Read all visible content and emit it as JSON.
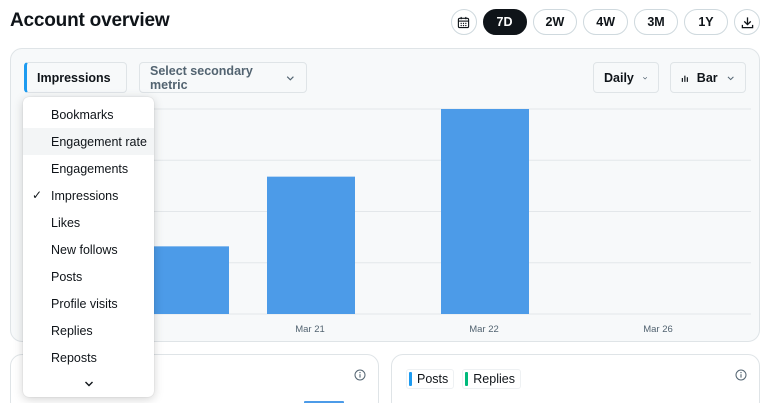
{
  "header": {
    "title": "Account overview",
    "calendar_icon": "calendar-icon",
    "download_icon": "download-icon",
    "ranges": [
      {
        "label": "7D",
        "active": true
      },
      {
        "label": "2W",
        "active": false
      },
      {
        "label": "4W",
        "active": false
      },
      {
        "label": "3M",
        "active": false
      },
      {
        "label": "1Y",
        "active": false
      }
    ]
  },
  "controls": {
    "primary_metric": "Impressions",
    "secondary_metric_placeholder": "Select secondary metric",
    "interval": "Daily",
    "chart_type": "Bar",
    "chart_type_icon": "bar-chart-icon"
  },
  "dropdown": {
    "items": [
      {
        "label": "Bookmarks",
        "selected": false,
        "hover": false
      },
      {
        "label": "Engagement rate",
        "selected": false,
        "hover": true
      },
      {
        "label": "Engagements",
        "selected": false,
        "hover": false
      },
      {
        "label": "Impressions",
        "selected": true,
        "hover": false
      },
      {
        "label": "Likes",
        "selected": false,
        "hover": false
      },
      {
        "label": "New follows",
        "selected": false,
        "hover": false
      },
      {
        "label": "Posts",
        "selected": false,
        "hover": false
      },
      {
        "label": "Profile visits",
        "selected": false,
        "hover": false
      },
      {
        "label": "Replies",
        "selected": false,
        "hover": false
      },
      {
        "label": "Reposts",
        "selected": false,
        "hover": false
      }
    ],
    "check_mark": "✓",
    "more_icon": "chevron-down-icon"
  },
  "chart_data": {
    "type": "bar",
    "x_ticks": [
      "Mar 21",
      "Mar 22",
      "Mar 26"
    ],
    "bars": [
      {
        "relative_value": 0.33
      },
      {
        "relative_value": 0.67
      },
      {
        "relative_value": 1.0
      }
    ],
    "bar_color": "#4c9be8",
    "grid": true
  },
  "bottom": {
    "legend": [
      {
        "label": "Posts",
        "color": "#1d9bf0"
      },
      {
        "label": "Replies",
        "color": "#00ba7c"
      }
    ]
  },
  "colors": {
    "accent": "#1d9bf0",
    "active_pill": "#0f1419"
  }
}
